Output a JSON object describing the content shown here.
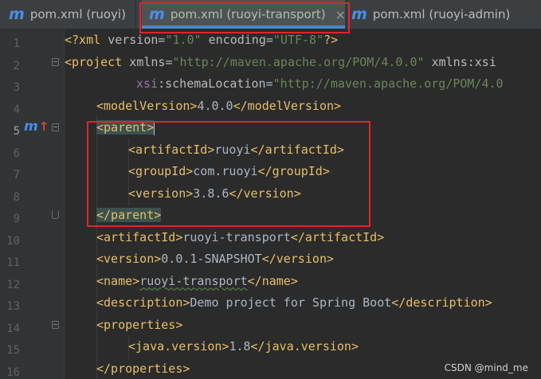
{
  "tabs": [
    {
      "prefix": "m",
      "label": "pom.xml (ruoyi)"
    },
    {
      "prefix": "m",
      "label": "pom.xml (ruoyi-transport)",
      "close": "×"
    },
    {
      "prefix": "m",
      "label": "pom.xml (ruoyi-admin)"
    }
  ],
  "gutter": {
    "line_numbers": [
      "1",
      "2",
      "3",
      "4",
      "5",
      "6",
      "7",
      "8",
      "9",
      "10",
      "11",
      "12",
      "13",
      "14",
      "15",
      "16"
    ],
    "current_line": "5",
    "maven_marker": {
      "letter": "m",
      "arrow": "↑"
    }
  },
  "code": {
    "l1": {
      "open": "<?xml ",
      "a1": "version",
      "eq1": "=",
      "v1": "\"1.0\"",
      "sp": " ",
      "a2": "encoding",
      "eq2": "=",
      "v2": "\"UTF-8\"",
      "close": "?>"
    },
    "l2": {
      "open": "<project ",
      "a1": "xmlns",
      "eq1": "=",
      "v1": "\"http://maven.apache.org/POM/4.0.0\"",
      "sp": " ",
      "a2": "xmlns:xsi"
    },
    "l3": {
      "ns": "xsi",
      "a1": ":schemaLocation",
      "eq1": "=",
      "v1": "\"http://maven.apache.org/POM/4.0"
    },
    "l4": {
      "open": "<modelVersion>",
      "text": "4.0.0",
      "close": "</modelVersion>"
    },
    "l5": {
      "open": "<parent>"
    },
    "l6": {
      "open": "<artifactId>",
      "text": "ruoyi",
      "close": "</artifactId>"
    },
    "l7": {
      "open": "<groupId>",
      "text": "com.ruoyi",
      "close": "</groupId>"
    },
    "l8": {
      "open": "<version>",
      "text": "3.8.6",
      "close": "</version>"
    },
    "l9": {
      "close": "</parent>"
    },
    "l10": {
      "open": "<artifactId>",
      "text": "ruoyi-transport",
      "close": "</artifactId>"
    },
    "l11": {
      "open": "<version>",
      "text": "0.0.1-SNAPSHOT",
      "close": "</version>"
    },
    "l12": {
      "open": "<name>",
      "text": "ruoyi-transport",
      "close": "</name>"
    },
    "l13": {
      "open": "<description>",
      "text": "Demo project for Spring Boot",
      "close": "</description>"
    },
    "l14": {
      "open": "<properties>"
    },
    "l15": {
      "open": "<java.version>",
      "text": "1.8",
      "close": "</java.version>"
    },
    "l16": {
      "close": "</properties>"
    }
  },
  "watermark": "CSDN @mind_me",
  "colors": {
    "background": "#2b2b2b",
    "tag": "#e8bf6a",
    "string": "#6a8759",
    "highlight_box": "#e0242b",
    "maven_icon": "#4b8ee8"
  }
}
